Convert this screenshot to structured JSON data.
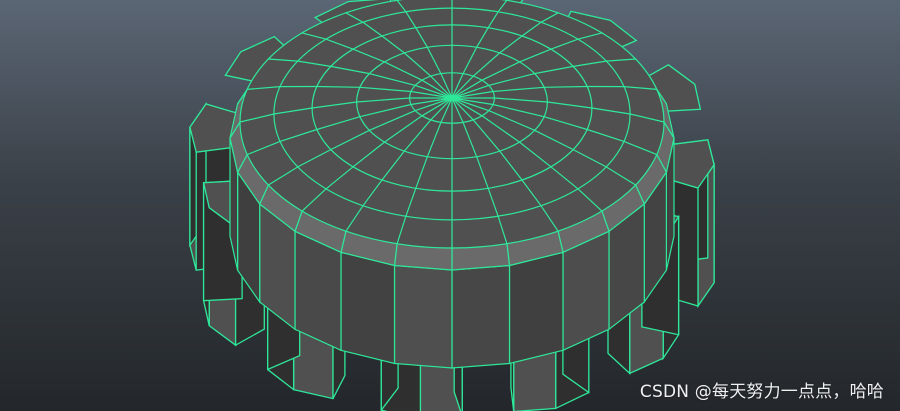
{
  "viewport": {
    "background_top": "#5b6675",
    "background_bottom": "#23272b"
  },
  "model": {
    "type": "gear-knob-mesh",
    "wire_color": "#2ee89a",
    "face_color": "#505050",
    "side_dark_color": "#2f2f2f"
  },
  "watermark": {
    "text": "CSDN @每天努力一点点，哈哈"
  }
}
